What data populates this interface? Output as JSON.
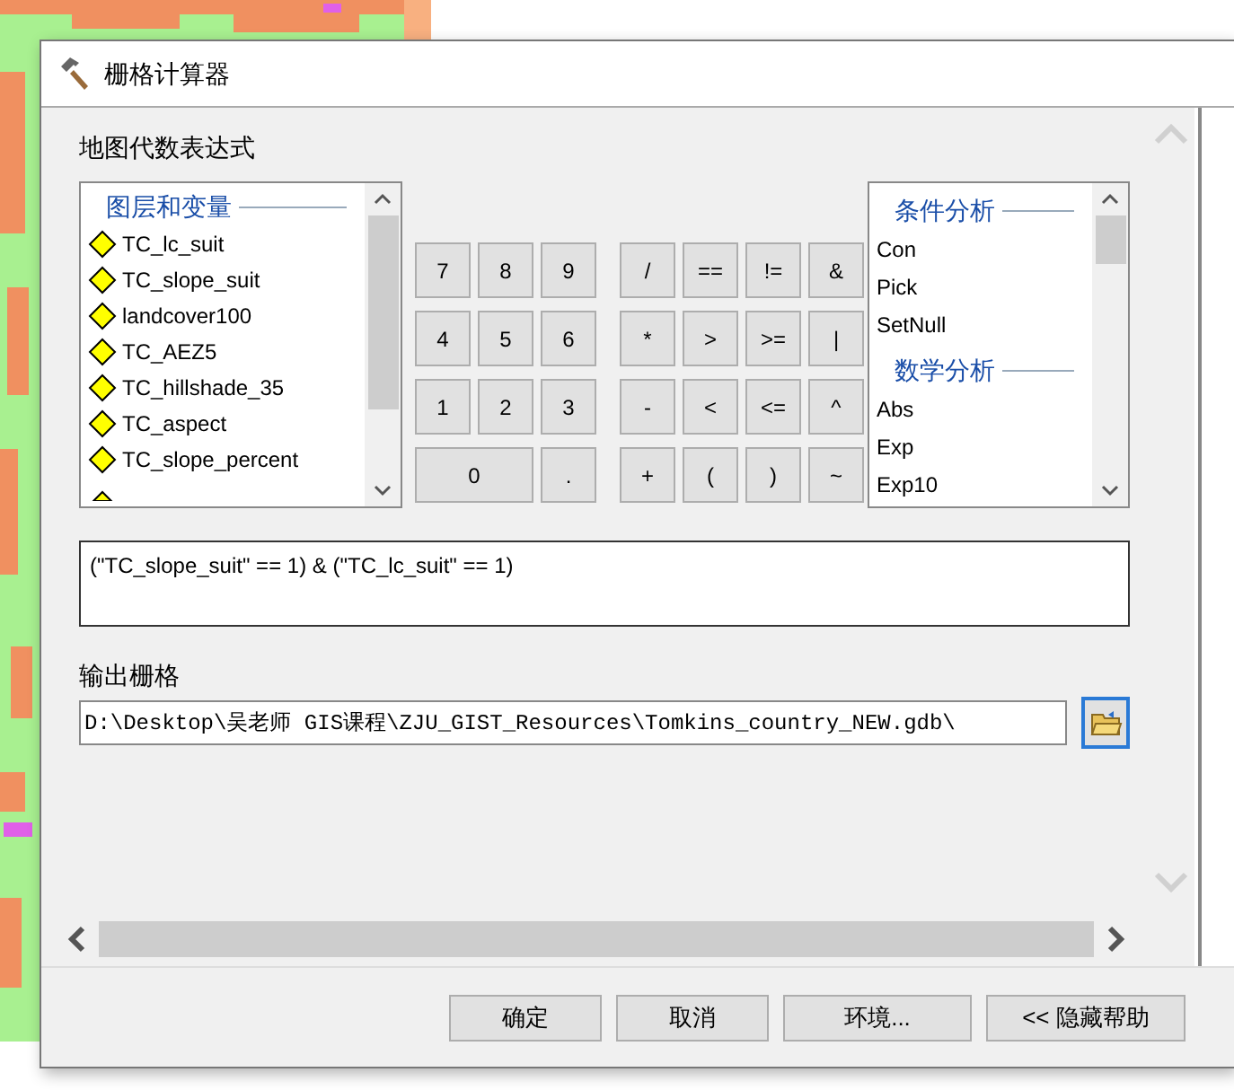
{
  "window": {
    "title": "栅格计算器"
  },
  "expression_label": "地图代数表达式",
  "layers": {
    "header": "图层和变量",
    "items": [
      "TC_lc_suit",
      "TC_slope_suit",
      "landcover100",
      "TC_AEZ5",
      "TC_hillshade_35",
      "TC_aspect",
      "TC_slope_percent"
    ]
  },
  "keypad": [
    [
      {
        "label": "7",
        "kind": "key"
      },
      {
        "label": "8",
        "kind": "key"
      },
      {
        "label": "9",
        "kind": "key"
      },
      {
        "label": "/",
        "kind": "key"
      },
      {
        "label": "==",
        "kind": "key"
      },
      {
        "label": "!=",
        "kind": "key"
      },
      {
        "label": "&",
        "kind": "key"
      }
    ],
    [
      {
        "label": "4",
        "kind": "key"
      },
      {
        "label": "5",
        "kind": "key"
      },
      {
        "label": "6",
        "kind": "key"
      },
      {
        "label": "*",
        "kind": "key"
      },
      {
        "label": ">",
        "kind": "key"
      },
      {
        "label": ">=",
        "kind": "key"
      },
      {
        "label": "|",
        "kind": "key"
      }
    ],
    [
      {
        "label": "1",
        "kind": "key"
      },
      {
        "label": "2",
        "kind": "key"
      },
      {
        "label": "3",
        "kind": "key"
      },
      {
        "label": "-",
        "kind": "key"
      },
      {
        "label": "<",
        "kind": "key"
      },
      {
        "label": "<=",
        "kind": "key"
      },
      {
        "label": "^",
        "kind": "key"
      }
    ],
    [
      {
        "label": "0",
        "kind": "wide"
      },
      {
        "label": ".",
        "kind": "key"
      },
      {
        "label": "+",
        "kind": "key"
      },
      {
        "label": "(",
        "kind": "key"
      },
      {
        "label": ")",
        "kind": "key"
      },
      {
        "label": "~",
        "kind": "key"
      }
    ]
  ],
  "functions": [
    {
      "header": "条件分析",
      "items": [
        "Con",
        "Pick",
        "SetNull"
      ]
    },
    {
      "header": "数学分析",
      "items": [
        "Abs",
        "Exp",
        "Exp10"
      ]
    }
  ],
  "expression": "(\"TC_slope_suit\" == 1) & (\"TC_lc_suit\" == 1)",
  "output": {
    "label": "输出栅格",
    "value": "D:\\Desktop\\吴老师 GIS课程\\ZJU_GIST_Resources\\Tomkins_country_NEW.gdb\\"
  },
  "buttons": [
    "确定",
    "取消",
    "环境...",
    "<< 隐藏帮助"
  ]
}
